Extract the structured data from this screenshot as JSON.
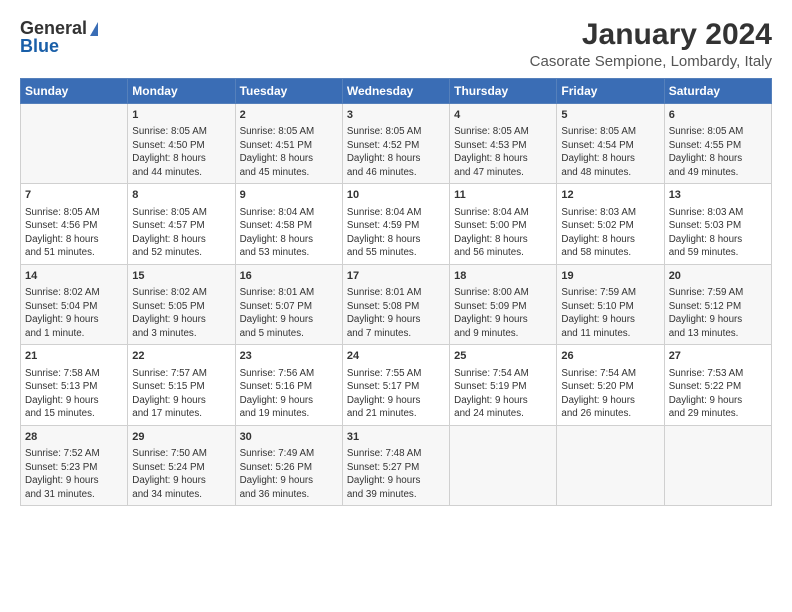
{
  "header": {
    "logo_general": "General",
    "logo_blue": "Blue",
    "title": "January 2024",
    "subtitle": "Casorate Sempione, Lombardy, Italy"
  },
  "days_of_week": [
    "Sunday",
    "Monday",
    "Tuesday",
    "Wednesday",
    "Thursday",
    "Friday",
    "Saturday"
  ],
  "weeks": [
    [
      {
        "day": "",
        "content": ""
      },
      {
        "day": "1",
        "content": "Sunrise: 8:05 AM\nSunset: 4:50 PM\nDaylight: 8 hours\nand 44 minutes."
      },
      {
        "day": "2",
        "content": "Sunrise: 8:05 AM\nSunset: 4:51 PM\nDaylight: 8 hours\nand 45 minutes."
      },
      {
        "day": "3",
        "content": "Sunrise: 8:05 AM\nSunset: 4:52 PM\nDaylight: 8 hours\nand 46 minutes."
      },
      {
        "day": "4",
        "content": "Sunrise: 8:05 AM\nSunset: 4:53 PM\nDaylight: 8 hours\nand 47 minutes."
      },
      {
        "day": "5",
        "content": "Sunrise: 8:05 AM\nSunset: 4:54 PM\nDaylight: 8 hours\nand 48 minutes."
      },
      {
        "day": "6",
        "content": "Sunrise: 8:05 AM\nSunset: 4:55 PM\nDaylight: 8 hours\nand 49 minutes."
      }
    ],
    [
      {
        "day": "7",
        "content": "Sunrise: 8:05 AM\nSunset: 4:56 PM\nDaylight: 8 hours\nand 51 minutes."
      },
      {
        "day": "8",
        "content": "Sunrise: 8:05 AM\nSunset: 4:57 PM\nDaylight: 8 hours\nand 52 minutes."
      },
      {
        "day": "9",
        "content": "Sunrise: 8:04 AM\nSunset: 4:58 PM\nDaylight: 8 hours\nand 53 minutes."
      },
      {
        "day": "10",
        "content": "Sunrise: 8:04 AM\nSunset: 4:59 PM\nDaylight: 8 hours\nand 55 minutes."
      },
      {
        "day": "11",
        "content": "Sunrise: 8:04 AM\nSunset: 5:00 PM\nDaylight: 8 hours\nand 56 minutes."
      },
      {
        "day": "12",
        "content": "Sunrise: 8:03 AM\nSunset: 5:02 PM\nDaylight: 8 hours\nand 58 minutes."
      },
      {
        "day": "13",
        "content": "Sunrise: 8:03 AM\nSunset: 5:03 PM\nDaylight: 8 hours\nand 59 minutes."
      }
    ],
    [
      {
        "day": "14",
        "content": "Sunrise: 8:02 AM\nSunset: 5:04 PM\nDaylight: 9 hours\nand 1 minute."
      },
      {
        "day": "15",
        "content": "Sunrise: 8:02 AM\nSunset: 5:05 PM\nDaylight: 9 hours\nand 3 minutes."
      },
      {
        "day": "16",
        "content": "Sunrise: 8:01 AM\nSunset: 5:07 PM\nDaylight: 9 hours\nand 5 minutes."
      },
      {
        "day": "17",
        "content": "Sunrise: 8:01 AM\nSunset: 5:08 PM\nDaylight: 9 hours\nand 7 minutes."
      },
      {
        "day": "18",
        "content": "Sunrise: 8:00 AM\nSunset: 5:09 PM\nDaylight: 9 hours\nand 9 minutes."
      },
      {
        "day": "19",
        "content": "Sunrise: 7:59 AM\nSunset: 5:10 PM\nDaylight: 9 hours\nand 11 minutes."
      },
      {
        "day": "20",
        "content": "Sunrise: 7:59 AM\nSunset: 5:12 PM\nDaylight: 9 hours\nand 13 minutes."
      }
    ],
    [
      {
        "day": "21",
        "content": "Sunrise: 7:58 AM\nSunset: 5:13 PM\nDaylight: 9 hours\nand 15 minutes."
      },
      {
        "day": "22",
        "content": "Sunrise: 7:57 AM\nSunset: 5:15 PM\nDaylight: 9 hours\nand 17 minutes."
      },
      {
        "day": "23",
        "content": "Sunrise: 7:56 AM\nSunset: 5:16 PM\nDaylight: 9 hours\nand 19 minutes."
      },
      {
        "day": "24",
        "content": "Sunrise: 7:55 AM\nSunset: 5:17 PM\nDaylight: 9 hours\nand 21 minutes."
      },
      {
        "day": "25",
        "content": "Sunrise: 7:54 AM\nSunset: 5:19 PM\nDaylight: 9 hours\nand 24 minutes."
      },
      {
        "day": "26",
        "content": "Sunrise: 7:54 AM\nSunset: 5:20 PM\nDaylight: 9 hours\nand 26 minutes."
      },
      {
        "day": "27",
        "content": "Sunrise: 7:53 AM\nSunset: 5:22 PM\nDaylight: 9 hours\nand 29 minutes."
      }
    ],
    [
      {
        "day": "28",
        "content": "Sunrise: 7:52 AM\nSunset: 5:23 PM\nDaylight: 9 hours\nand 31 minutes."
      },
      {
        "day": "29",
        "content": "Sunrise: 7:50 AM\nSunset: 5:24 PM\nDaylight: 9 hours\nand 34 minutes."
      },
      {
        "day": "30",
        "content": "Sunrise: 7:49 AM\nSunset: 5:26 PM\nDaylight: 9 hours\nand 36 minutes."
      },
      {
        "day": "31",
        "content": "Sunrise: 7:48 AM\nSunset: 5:27 PM\nDaylight: 9 hours\nand 39 minutes."
      },
      {
        "day": "",
        "content": ""
      },
      {
        "day": "",
        "content": ""
      },
      {
        "day": "",
        "content": ""
      }
    ]
  ]
}
